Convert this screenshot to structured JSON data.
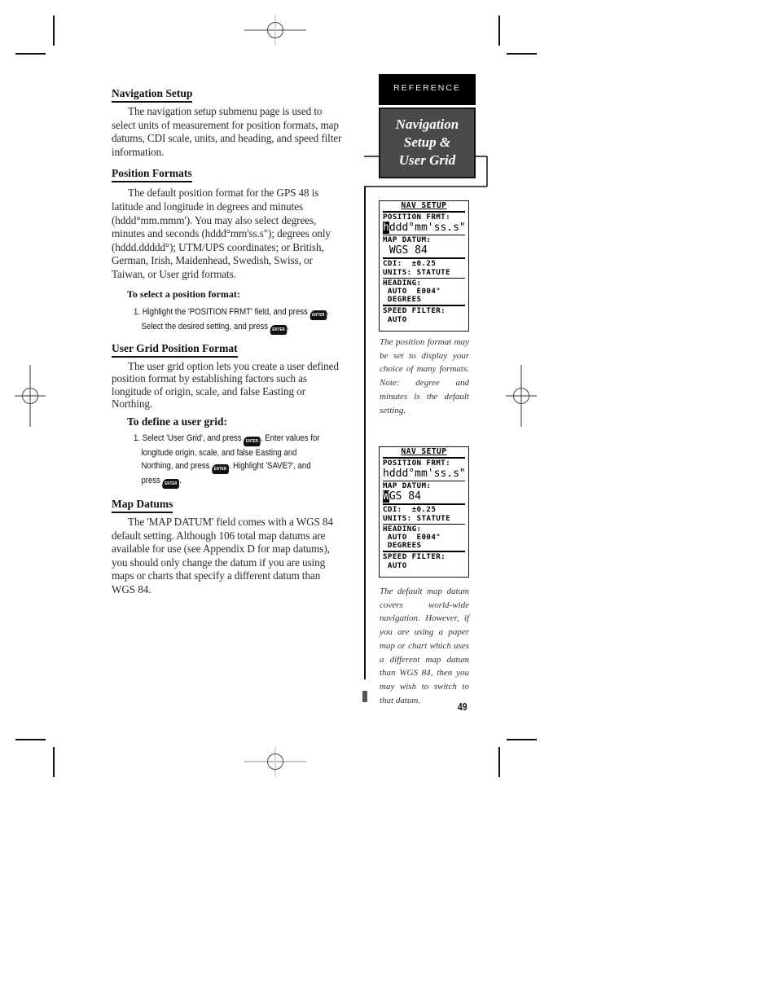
{
  "main": {
    "sections": [
      {
        "heading": "Navigation Setup",
        "paragraph": "The navigation setup submenu page is used to select units of measurement for position formats, map datums, CDI scale, units, and heading, and speed filter information."
      },
      {
        "heading": "Position Formats",
        "paragraph": "The default position format for the GPS 48 is latitude and longitude in degrees and minutes (hddd°mm.mmm'). You may also select degrees, minutes and seconds (hddd°mm'ss.s\"); degrees only (hddd.ddddd°); UTM/UPS coordinates; or British, German, Irish, Maidenhead, Swedish, Swiss, or Taiwan, or User grid formats.",
        "procedure_title": "To select a position format:",
        "step": {
          "part1": "1. Highlight the 'POSITION FRMT' field, and press",
          "part2": "Select the desired setting, and press",
          "part3": "."
        }
      },
      {
        "heading": "User Grid Position Format",
        "paragraph": "The user grid option lets you create a user defined position format by establishing factors such as longitude of origin, scale, and false Easting or Northing.",
        "procedure_title": "To define a user grid:",
        "step": {
          "part1": "1. Select 'User Grid', and press",
          "part2": ". Enter values for",
          "part3": "longitude origin, scale, and false Easting and",
          "part4": "Northing, and press",
          "part5": ". Highlight 'SAVE?', and",
          "part6": "press",
          "part7": "."
        }
      },
      {
        "heading": "Map Datums",
        "paragraph": "The 'MAP DATUM' field comes with a WGS 84 default setting. Although 106 total map datums are available for use (see Appendix D for map datums), you should only change the datum if you are using maps or charts that specify a different datum than WGS 84."
      }
    ],
    "enter_key_label": "ENTER"
  },
  "sidebar": {
    "tab_label": "REFERENCE",
    "title_lines": [
      "Navigation",
      "Setup &",
      "User Grid"
    ],
    "screens": [
      {
        "title": "NAV SETUP",
        "position_label": "POSITION FRMT:",
        "position_cursor": "h",
        "position_value": "ddd°mm'ss.s\"",
        "datum_label": "MAP DATUM:",
        "datum_cursor": "",
        "datum_value": "WGS 84",
        "cdi": "CDI:  ±0.25",
        "units": "UNITS: STATUTE",
        "heading_label": "HEADING:",
        "heading_value": " AUTO  E004°",
        "heading_unit": " DEGREES",
        "speed_label": "SPEED FILTER:",
        "speed_value": " AUTO",
        "caption": "The position format may be set to display your choice of many formats. Note: degree and minutes is the default setting."
      },
      {
        "title": "NAV SETUP",
        "position_label": "POSITION FRMT:",
        "position_cursor": "",
        "position_value": "hddd°mm'ss.s\"",
        "datum_label": "MAP DATUM:",
        "datum_cursor": "W",
        "datum_value": "GS 84",
        "cdi": "CDI:  ±0.25",
        "units": "UNITS: STATUTE",
        "heading_label": "HEADING:",
        "heading_value": " AUTO  E004°",
        "heading_unit": " DEGREES",
        "speed_label": "SPEED FILTER:",
        "speed_value": " AUTO",
        "caption": "The default map datum covers world-wide navigation. However, if you are using a paper map or chart which uses a different map datum than WGS 84, then you may wish to switch to that datum."
      }
    ]
  },
  "page_number": "49"
}
